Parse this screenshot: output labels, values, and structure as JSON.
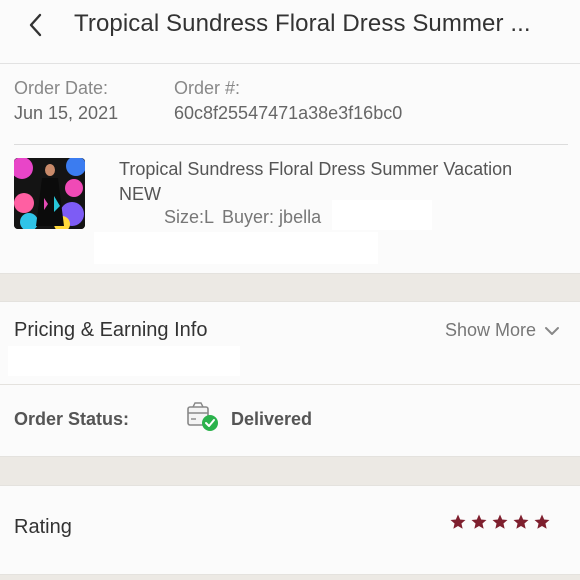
{
  "header": {
    "title": "Tropical Sundress Floral Dress Summer ..."
  },
  "order": {
    "date_label": "Order Date:",
    "date_value": "Jun 15, 2021",
    "number_label": "Order #:",
    "number_value": "60c8f25547471a38e3f16bc0"
  },
  "product": {
    "title": "Tropical Sundress Floral Dress Summer Vacation NEW",
    "size": "Size:L",
    "buyer": "Buyer: jbella"
  },
  "pricing": {
    "title": "Pricing & Earning Info",
    "show_more": "Show More"
  },
  "status": {
    "label": "Order Status:",
    "value": "Delivered",
    "icon": "package-delivered-icon",
    "check_color": "#2bb24c"
  },
  "rating": {
    "label": "Rating",
    "stars": 5,
    "max_stars": 5,
    "star_color": "#7e1f2e"
  }
}
